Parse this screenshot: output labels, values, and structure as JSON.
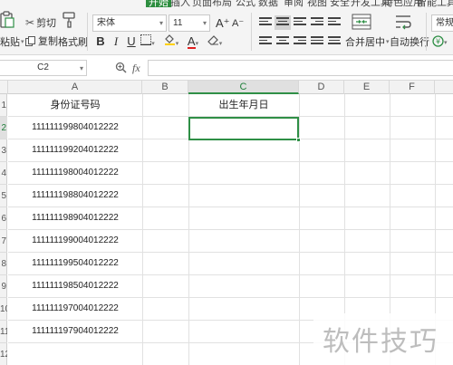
{
  "menu": {
    "items": [
      "开始",
      "插入",
      "页面布局",
      "公式",
      "数据",
      "审阅",
      "视图",
      "安全",
      "开发工具",
      "特色应用",
      "智能工具箱"
    ],
    "active": "开始"
  },
  "ribbon": {
    "paste_label": "粘贴",
    "cut_label": "剪切",
    "copy_label": "复制",
    "format_painter_label": "格式刷",
    "font_name": "宋体",
    "font_size": "11",
    "grow_font": "A⁺",
    "shrink_font": "A⁻",
    "bold": "B",
    "italic": "I",
    "underline": "U",
    "font_color": "A",
    "merge_center_label": "合并居中",
    "wrap_text_label": "自动换行",
    "number_format": "常规",
    "accent_color": "#2f8f46",
    "font_color_bar": "#e02020",
    "fill_color_bar": "#ffd000"
  },
  "formula_bar": {
    "name_box": "C2",
    "fx_label": "fx",
    "formula": ""
  },
  "sheet": {
    "columns": [
      "A",
      "B",
      "C",
      "D",
      "E",
      "F"
    ],
    "active_column": "C",
    "rows": [
      "1",
      "2",
      "3",
      "4",
      "5",
      "6",
      "7",
      "8",
      "9",
      "10",
      "11",
      "12"
    ],
    "active_row": "2",
    "header_A": "身份证号码",
    "header_C": "出生年月日",
    "id_numbers": [
      "111111199804012222",
      "111111199204012222",
      "111111198004012222",
      "111111198804012222",
      "111111198904012222",
      "111111199004012222",
      "111111199504012222",
      "111111198504012222",
      "111111197004012222",
      "111111197904012222"
    ],
    "selected_cell": "C2"
  },
  "watermark": "软件技巧"
}
